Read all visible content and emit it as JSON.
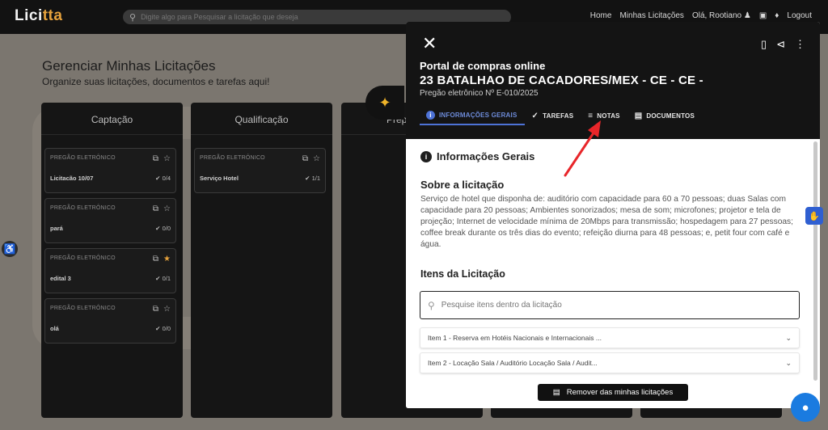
{
  "app": {
    "logo_main": "Lici",
    "logo_accent": "tta",
    "search_placeholder": "Digite algo para Pesquisar a licitação que deseja",
    "nav": {
      "home": "Home",
      "minhas": "Minhas Licitações",
      "user": "Olá, Rootiano",
      "logout": "Logout"
    }
  },
  "page": {
    "title": "Gerenciar Minhas Licitações",
    "subtitle": "Organize suas licitações, documentos e tarefas aqui!"
  },
  "columns": [
    {
      "title": "Captação",
      "cards": [
        {
          "type": "PREGÃO ELETRÔNICO",
          "name": "Licitacão 10/07",
          "count": "0/4",
          "starred": false
        },
        {
          "type": "PREGÃO ELETRÔNICO",
          "name": "pará",
          "count": "0/0",
          "starred": false
        },
        {
          "type": "PREGÃO ELETRÔNICO",
          "name": "edital 3",
          "count": "0/1",
          "starred": true
        },
        {
          "type": "PREGÃO ELETRÔNICO",
          "name": "olá",
          "count": "0/0",
          "starred": false
        }
      ]
    },
    {
      "title": "Qualificação",
      "cards": [
        {
          "type": "PREGÃO ELETRÔNICO",
          "name": "Serviço Hotel",
          "count": "1/1",
          "starred": false
        }
      ]
    },
    {
      "title": "Prep",
      "cards": []
    }
  ],
  "panel": {
    "portal": "Portal de compras online",
    "orgao": "23 BATALHAO DE CACADORES/MEX - CE - CE -",
    "pregao": "Pregão eletrônico Nº E-010/2025",
    "tabs": [
      {
        "label": "INFORMAÇÕES GERAIS",
        "icon": "info-icon",
        "active": true
      },
      {
        "label": "TAREFAS",
        "icon": "check-circle-icon",
        "active": false
      },
      {
        "label": "NOTAS",
        "icon": "notes-icon",
        "active": false
      },
      {
        "label": "DOCUMENTOS",
        "icon": "document-icon",
        "active": false
      }
    ],
    "section_title": "Informações Gerais",
    "sobre_title": "Sobre a licitação",
    "description": "Serviço de hotel que disponha de: auditório com capacidade para 60 a 70 pessoas; duas Salas com capacidade para 20 pessoas; Ambientes sonorizados; mesa de som; microfones; projetor e tela de projeção; Internet de velocidade mínima de 20Mbps para transmissão; hospedagem para 27 pessoas; coffee break durante os três dias do evento; refeição diurna para 48 pessoas; e, petit four com café e água.",
    "itens_title": "Itens da Licitação",
    "itens_placeholder": "Pesquise itens dentro da licitação",
    "itens": [
      "Item 1 - Reserva em Hotéis Nacionais e Internacionais ...",
      "Item 2 - Locação Sala / Auditório Locação Sala / Audit..."
    ],
    "remove_label": "Remover das minhas licitações"
  },
  "colors": {
    "accent": "#4d72d6",
    "star": "#e6a23c",
    "arrow": "#e8262a"
  }
}
